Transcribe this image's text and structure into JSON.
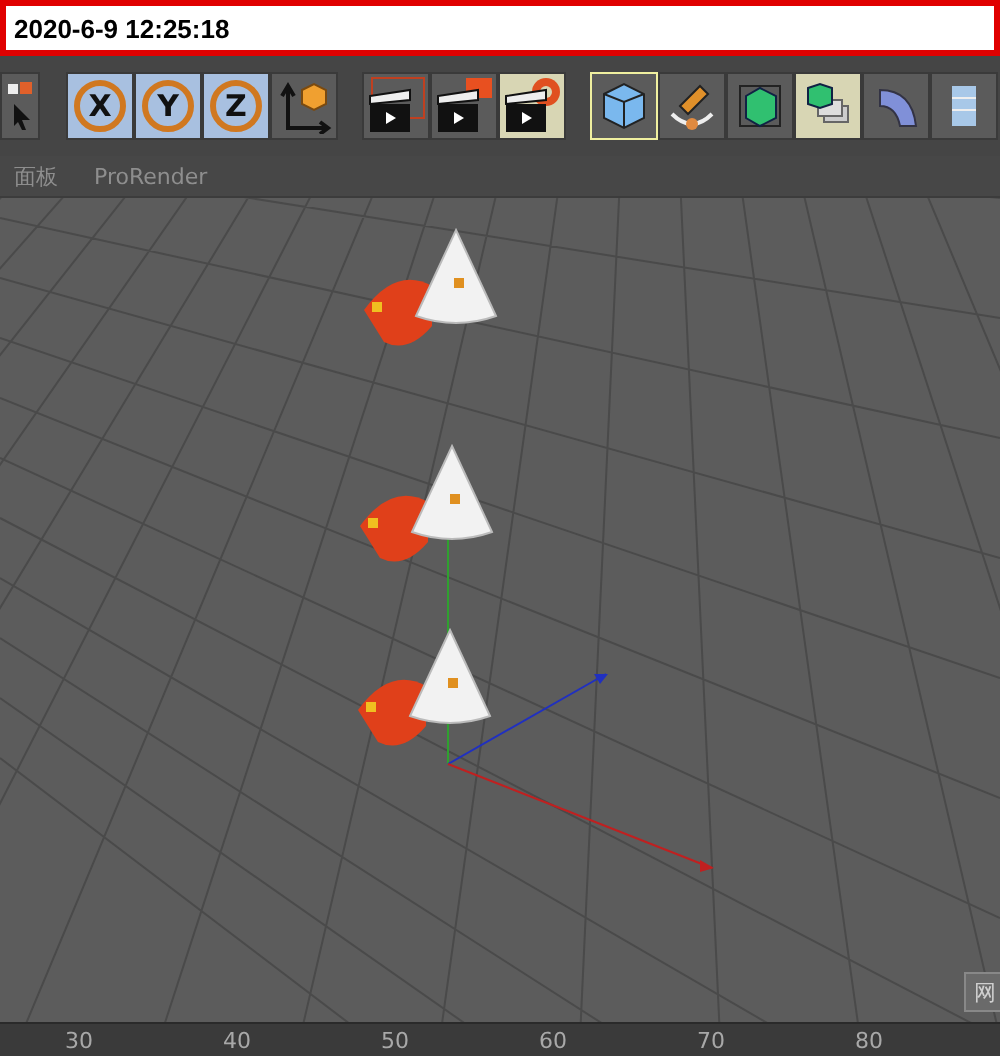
{
  "timestamp": "2020-6-9 12:25:18",
  "toolbar": [
    {
      "kind": "select",
      "selected": false
    },
    {
      "kind": "axis",
      "label": "X",
      "selected": true
    },
    {
      "kind": "axis",
      "label": "Y",
      "selected": true
    },
    {
      "kind": "axis",
      "label": "Z",
      "selected": true
    },
    {
      "kind": "coords",
      "selected": false
    },
    {
      "kind": "render-region",
      "selected": false
    },
    {
      "kind": "render-view",
      "selected": false
    },
    {
      "kind": "render-settings",
      "selected": true
    },
    {
      "kind": "cube",
      "selected": true
    },
    {
      "kind": "pen",
      "selected": false
    },
    {
      "kind": "subdivision",
      "selected": false
    },
    {
      "kind": "cloner",
      "selected": true
    },
    {
      "kind": "deformer",
      "selected": false
    },
    {
      "kind": "scene",
      "selected": false
    }
  ],
  "menu": [
    "面板",
    "ProRender"
  ],
  "viewport_tab": "网",
  "ruler": [
    "30",
    "40",
    "50",
    "60",
    "70",
    "80"
  ]
}
